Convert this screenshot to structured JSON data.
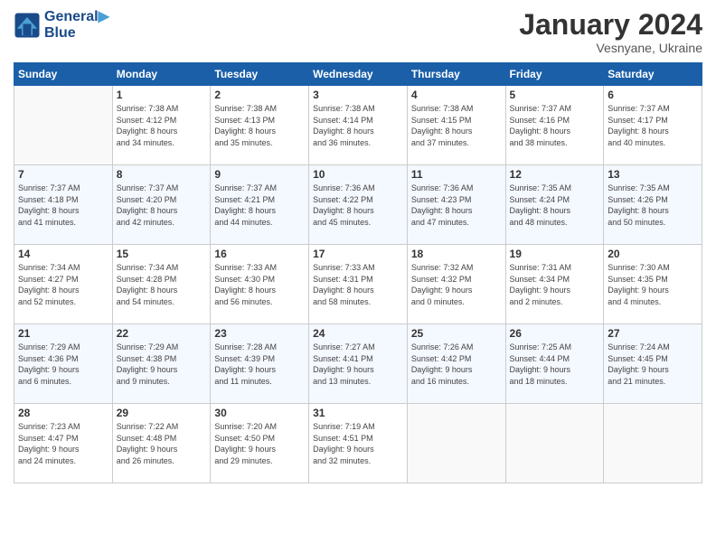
{
  "header": {
    "logo_line1": "General",
    "logo_line2": "Blue",
    "month": "January 2024",
    "location": "Vesnyane, Ukraine"
  },
  "days_of_week": [
    "Sunday",
    "Monday",
    "Tuesday",
    "Wednesday",
    "Thursday",
    "Friday",
    "Saturday"
  ],
  "weeks": [
    [
      {
        "day": "",
        "sunrise": "",
        "sunset": "",
        "daylight": ""
      },
      {
        "day": "1",
        "sunrise": "Sunrise: 7:38 AM",
        "sunset": "Sunset: 4:12 PM",
        "daylight": "Daylight: 8 hours and 34 minutes."
      },
      {
        "day": "2",
        "sunrise": "Sunrise: 7:38 AM",
        "sunset": "Sunset: 4:13 PM",
        "daylight": "Daylight: 8 hours and 35 minutes."
      },
      {
        "day": "3",
        "sunrise": "Sunrise: 7:38 AM",
        "sunset": "Sunset: 4:14 PM",
        "daylight": "Daylight: 8 hours and 36 minutes."
      },
      {
        "day": "4",
        "sunrise": "Sunrise: 7:38 AM",
        "sunset": "Sunset: 4:15 PM",
        "daylight": "Daylight: 8 hours and 37 minutes."
      },
      {
        "day": "5",
        "sunrise": "Sunrise: 7:37 AM",
        "sunset": "Sunset: 4:16 PM",
        "daylight": "Daylight: 8 hours and 38 minutes."
      },
      {
        "day": "6",
        "sunrise": "Sunrise: 7:37 AM",
        "sunset": "Sunset: 4:17 PM",
        "daylight": "Daylight: 8 hours and 40 minutes."
      }
    ],
    [
      {
        "day": "7",
        "sunrise": "Sunrise: 7:37 AM",
        "sunset": "Sunset: 4:18 PM",
        "daylight": "Daylight: 8 hours and 41 minutes."
      },
      {
        "day": "8",
        "sunrise": "Sunrise: 7:37 AM",
        "sunset": "Sunset: 4:20 PM",
        "daylight": "Daylight: 8 hours and 42 minutes."
      },
      {
        "day": "9",
        "sunrise": "Sunrise: 7:37 AM",
        "sunset": "Sunset: 4:21 PM",
        "daylight": "Daylight: 8 hours and 44 minutes."
      },
      {
        "day": "10",
        "sunrise": "Sunrise: 7:36 AM",
        "sunset": "Sunset: 4:22 PM",
        "daylight": "Daylight: 8 hours and 45 minutes."
      },
      {
        "day": "11",
        "sunrise": "Sunrise: 7:36 AM",
        "sunset": "Sunset: 4:23 PM",
        "daylight": "Daylight: 8 hours and 47 minutes."
      },
      {
        "day": "12",
        "sunrise": "Sunrise: 7:35 AM",
        "sunset": "Sunset: 4:24 PM",
        "daylight": "Daylight: 8 hours and 48 minutes."
      },
      {
        "day": "13",
        "sunrise": "Sunrise: 7:35 AM",
        "sunset": "Sunset: 4:26 PM",
        "daylight": "Daylight: 8 hours and 50 minutes."
      }
    ],
    [
      {
        "day": "14",
        "sunrise": "Sunrise: 7:34 AM",
        "sunset": "Sunset: 4:27 PM",
        "daylight": "Daylight: 8 hours and 52 minutes."
      },
      {
        "day": "15",
        "sunrise": "Sunrise: 7:34 AM",
        "sunset": "Sunset: 4:28 PM",
        "daylight": "Daylight: 8 hours and 54 minutes."
      },
      {
        "day": "16",
        "sunrise": "Sunrise: 7:33 AM",
        "sunset": "Sunset: 4:30 PM",
        "daylight": "Daylight: 8 hours and 56 minutes."
      },
      {
        "day": "17",
        "sunrise": "Sunrise: 7:33 AM",
        "sunset": "Sunset: 4:31 PM",
        "daylight": "Daylight: 8 hours and 58 minutes."
      },
      {
        "day": "18",
        "sunrise": "Sunrise: 7:32 AM",
        "sunset": "Sunset: 4:32 PM",
        "daylight": "Daylight: 9 hours and 0 minutes."
      },
      {
        "day": "19",
        "sunrise": "Sunrise: 7:31 AM",
        "sunset": "Sunset: 4:34 PM",
        "daylight": "Daylight: 9 hours and 2 minutes."
      },
      {
        "day": "20",
        "sunrise": "Sunrise: 7:30 AM",
        "sunset": "Sunset: 4:35 PM",
        "daylight": "Daylight: 9 hours and 4 minutes."
      }
    ],
    [
      {
        "day": "21",
        "sunrise": "Sunrise: 7:29 AM",
        "sunset": "Sunset: 4:36 PM",
        "daylight": "Daylight: 9 hours and 6 minutes."
      },
      {
        "day": "22",
        "sunrise": "Sunrise: 7:29 AM",
        "sunset": "Sunset: 4:38 PM",
        "daylight": "Daylight: 9 hours and 9 minutes."
      },
      {
        "day": "23",
        "sunrise": "Sunrise: 7:28 AM",
        "sunset": "Sunset: 4:39 PM",
        "daylight": "Daylight: 9 hours and 11 minutes."
      },
      {
        "day": "24",
        "sunrise": "Sunrise: 7:27 AM",
        "sunset": "Sunset: 4:41 PM",
        "daylight": "Daylight: 9 hours and 13 minutes."
      },
      {
        "day": "25",
        "sunrise": "Sunrise: 7:26 AM",
        "sunset": "Sunset: 4:42 PM",
        "daylight": "Daylight: 9 hours and 16 minutes."
      },
      {
        "day": "26",
        "sunrise": "Sunrise: 7:25 AM",
        "sunset": "Sunset: 4:44 PM",
        "daylight": "Daylight: 9 hours and 18 minutes."
      },
      {
        "day": "27",
        "sunrise": "Sunrise: 7:24 AM",
        "sunset": "Sunset: 4:45 PM",
        "daylight": "Daylight: 9 hours and 21 minutes."
      }
    ],
    [
      {
        "day": "28",
        "sunrise": "Sunrise: 7:23 AM",
        "sunset": "Sunset: 4:47 PM",
        "daylight": "Daylight: 9 hours and 24 minutes."
      },
      {
        "day": "29",
        "sunrise": "Sunrise: 7:22 AM",
        "sunset": "Sunset: 4:48 PM",
        "daylight": "Daylight: 9 hours and 26 minutes."
      },
      {
        "day": "30",
        "sunrise": "Sunrise: 7:20 AM",
        "sunset": "Sunset: 4:50 PM",
        "daylight": "Daylight: 9 hours and 29 minutes."
      },
      {
        "day": "31",
        "sunrise": "Sunrise: 7:19 AM",
        "sunset": "Sunset: 4:51 PM",
        "daylight": "Daylight: 9 hours and 32 minutes."
      },
      {
        "day": "",
        "sunrise": "",
        "sunset": "",
        "daylight": ""
      },
      {
        "day": "",
        "sunrise": "",
        "sunset": "",
        "daylight": ""
      },
      {
        "day": "",
        "sunrise": "",
        "sunset": "",
        "daylight": ""
      }
    ]
  ]
}
